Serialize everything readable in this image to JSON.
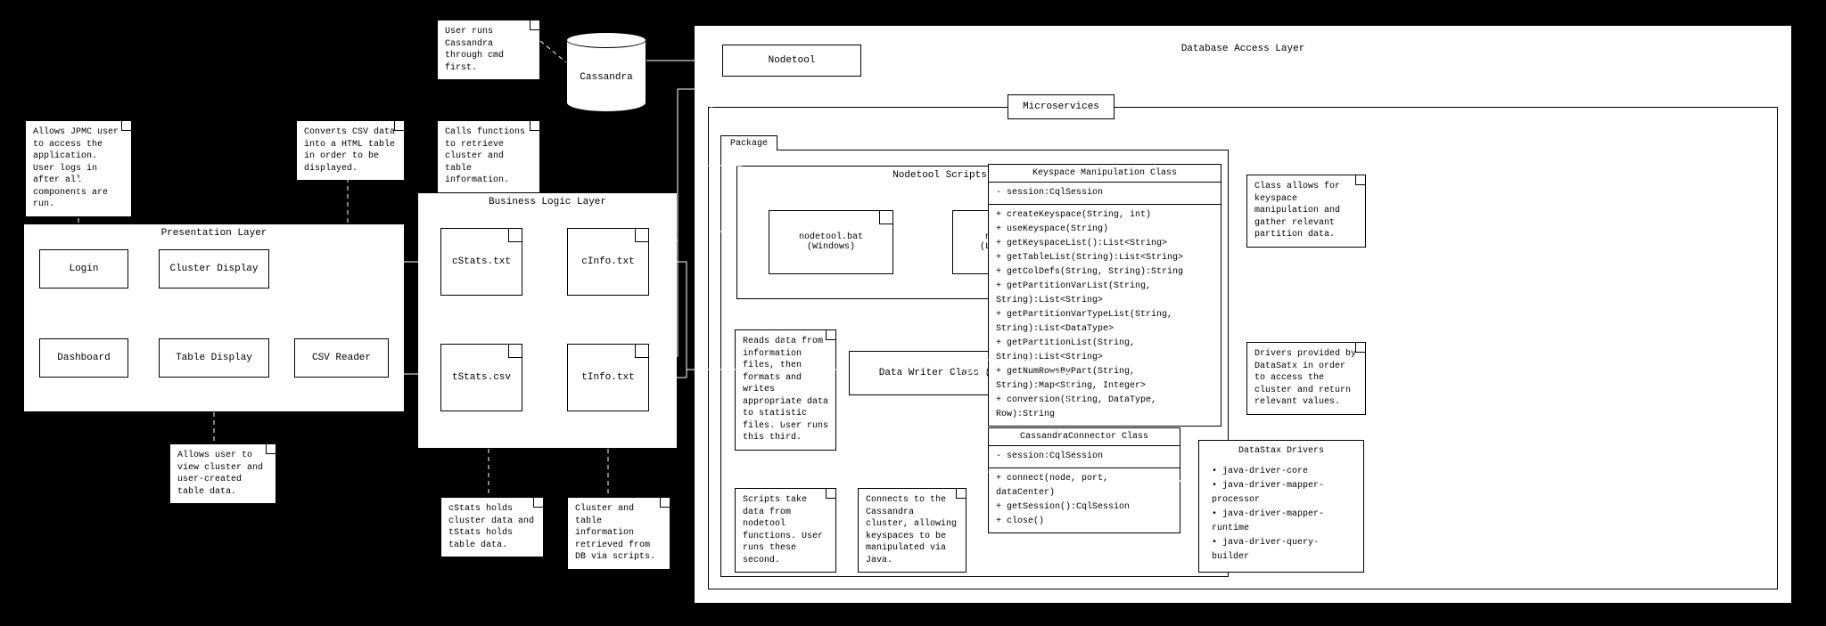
{
  "notes": {
    "jpmc": "Allows JPMC user to access the application. User logs in after all components are run.",
    "csv": "Converts CSV data into a HTML table in order to be displayed.",
    "cassandra_cmd": "User runs Cassandra through cmd first.",
    "calls_funcs": "Calls functions to retrieve cluster and table information.",
    "view_data": "Allows user to view cluster and user-created table data.",
    "cstats_tstats": "cStats holds cluster data and tStats holds table data.",
    "cluster_table": "Cluster and table information retrieved from DB via scripts.",
    "reads_data": "Reads data from information files, then formats and writes appropriate data to statistic files. User runs this third.",
    "scripts_take": "Scripts take data from nodetool functions. User runs these second.",
    "connects": "Connects to the Cassandra cluster, allowing keyspaces to be manipulated via Java.",
    "keyspace_note": "Class allows for keyspace manipulation and gather relevant partition data.",
    "drivers_note": "Drivers provided by DataSatx in order to access the cluster and return relevant values."
  },
  "layers": {
    "presentation": "Presentation Layer",
    "business": "Business Logic Layer",
    "dal": "Database Access Layer",
    "microservices": "Microservices",
    "package": "Package",
    "nodetool_scripts": "Nodetool Scripts"
  },
  "boxes": {
    "login": "Login",
    "dashboard": "Dashboard",
    "cluster_display": "Cluster Display",
    "table_display": "Table Display",
    "csv_reader": "CSV Reader",
    "cstats": "cStats.txt",
    "cinfo": "cInfo.txt",
    "tstats": "tStats.csv",
    "tinfo": "tInfo.txt",
    "cassandra": "Cassandra",
    "nodetool": "Nodetool",
    "bat": "nodetool.bat\n(Windows)",
    "sh": "nodetool.sh\n(Linux/MacOS)",
    "dwc": "Data Writer Class (Main)"
  },
  "classes": {
    "keyspace": {
      "title": "Keyspace Manipulation Class",
      "attrs": [
        "- session:CqlSession"
      ],
      "methods": [
        "+ createKeyspace(String, int)",
        "+ useKeyspace(String)",
        "+ getKeyspaceList():List<String>",
        "+ getTableList(String):List<String>",
        "+ getColDefs(String, String):String",
        "+ getPartitionVarList(String, String):List<String>",
        "+ getPartitionVarTypeList(String, String):List<DataType>",
        "+ getPartitionList(String, String):List<String>",
        "+ getNumRowsByPart(String, String):Map<String, Integer>",
        "+ conversion(String, DataType, Row):String"
      ]
    },
    "connector": {
      "title": "CassandraConnector Class",
      "attrs": [
        "- session:CqlSession"
      ],
      "methods": [
        "+ connect(node, port, dataCenter)",
        "+ getSession():CqlSession",
        "+ close()"
      ]
    },
    "drivers": {
      "title": "DataStax Drivers",
      "items": [
        "• java-driver-core",
        "• java-driver-mapper-processor",
        "• java-driver-mapper-runtime",
        "• java-driver-query-builder"
      ]
    }
  }
}
